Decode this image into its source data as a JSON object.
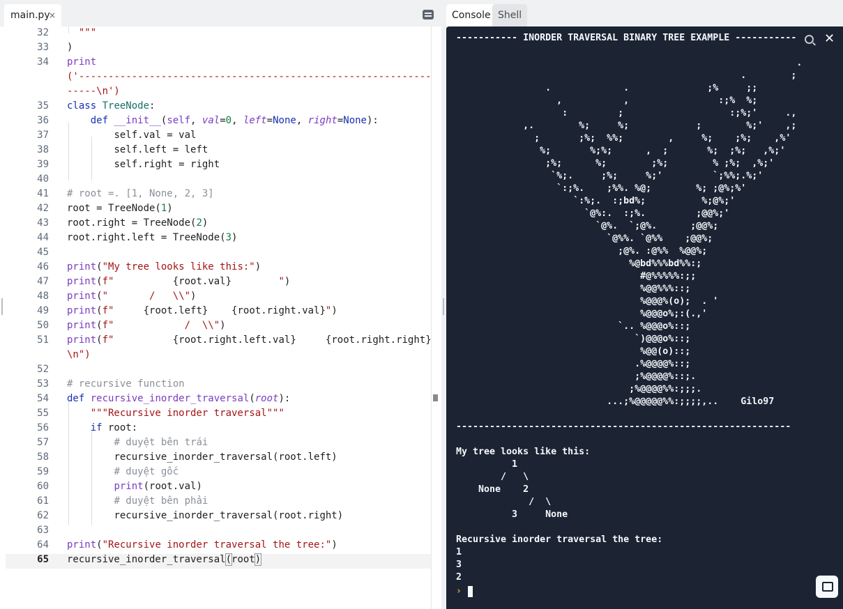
{
  "editor": {
    "file_tab": "main.py",
    "close_glyph": "×",
    "line_numbers": [
      "32",
      "33",
      "34",
      "35",
      "36",
      "37",
      "38",
      "39",
      "40",
      "41",
      "42",
      "43",
      "44",
      "45",
      "46",
      "47",
      "48",
      "49",
      "50",
      "51",
      "52",
      "53",
      "54",
      "55",
      "56",
      "57",
      "58",
      "59",
      "60",
      "61",
      "62",
      "63",
      "64",
      "65"
    ],
    "lines": {
      "l32": "  \"\"\"",
      "l33": ")",
      "l34a": "print",
      "l34b": "('--------------------------------------------------------------",
      "l34c": "-----\\n')",
      "l35_kw": "class",
      "l35_name": "TreeNode",
      "l36_def": "def",
      "l36_name": "__init__",
      "l36_self": "self",
      "l36_val": "val",
      "l36_zero": "0",
      "l36_left": "left",
      "l36_none1": "None",
      "l36_right": "right",
      "l36_none2": "None",
      "l37": "self.val = val",
      "l38": "self.left = left",
      "l39": "self.right = right",
      "l41": "# root =. [1, None, 2, 3]",
      "l42_a": "root = TreeNode(",
      "l42_n": "1",
      "l43_a": "root.right = TreeNode(",
      "l43_n": "2",
      "l44_a": "root.right.left = TreeNode(",
      "l44_n": "3",
      "l46_s": "\"My tree looks like this:\"",
      "l47_s1": "f\"          ",
      "l47_e": "{root.val}",
      "l47_s2": "        \"",
      "l48_s": "\"       /   \\\\\"",
      "l49_s1": "f\"     ",
      "l49_e1": "{root.left}",
      "l49_s2": "    ",
      "l49_e2": "{root.right.val}",
      "l49_s3": "\"",
      "l50_s": "f\"            /  \\\\\"",
      "l51_s1": "f\"          ",
      "l51_e1": "{root.right.left.val}",
      "l51_s2": "     ",
      "l51_e2": "{root.right.right}",
      "l51_cont": "\\n\")",
      "l53": "# recursive function",
      "l54_def": "def",
      "l54_name": "recursive_inorder_traversal",
      "l54_param": "root",
      "l55": "\"\"\"Recursive inorder traversal\"\"\"",
      "l56_kw": "if",
      "l56_rest": " root:",
      "l57": "# duyệt bên trái",
      "l58": "recursive_inorder_traversal(root.left)",
      "l59": "# duyệt gốc",
      "l60_fn": "print",
      "l60_rest": "(root.val)",
      "l61": "# duyệt bên phải",
      "l62": "recursive_inorder_traversal(root.right)",
      "l64_s": "\"Recursive inorder traversal the tree:\"",
      "l65_a": "recursive_inorder_traversal",
      "l65_b": "root",
      "print_kw": "print"
    }
  },
  "console": {
    "tabs": {
      "console": "Console",
      "shell": "Shell"
    },
    "output": "----------- INORDER TRAVERSAL BINARY TREE EXAMPLE -----------\n\n                                                             .\n                                                   .        ;\n                .             .              ;%     ;;\n                  ,           ,                :;%  %;\n                   :         ;                   :;%;'     .,\n            ,.        %;     %;            ;        %;'    ,;\n              ;       ;%;  %%;        ,     %;    ;%;    ,%'\n               %;       %;%;      ,  ;       %;  ;%;   ,%;'\n                ;%;      %;        ;%;        % ;%;  ,%;'\n                 `%;.     ;%;     %;'         `;%%;.%;'\n                  `:;%.    ;%%. %@;        %; ;@%;%'\n                     `:%;.  :;bd%;          %;@%;'\n                       `@%:.  :;%.         ;@@%;'\n                         `@%.  `;@%.      ;@@%;\n                           `@%%. `@%%    ;@@%;\n                             ;@%. :@%%  %@@%;\n                               %@bd%%%bd%%:;\n                                 #@%%%%%:;;\n                                 %@@%%%::;\n                                 %@@@%(o);  . '\n                                 %@@@o%;:(.,'\n                             `.. %@@@o%::;\n                                `)@@@o%::;\n                                 %@@(o)::;\n                                .%@@@@%::;\n                                ;%@@@@%::;.\n                               ;%@@@@%%:;;;.\n                           ...;%@@@@@%%:;;;;,..    Gilo97\n\n------------------------------------------------------------\n\nMy tree looks like this:\n          1\n        /   \\\n    None    2\n             /  \\\n          3     None\n\nRecursive inorder traversal the tree:\n1\n3\n2",
    "prompt": "›"
  },
  "icons": {
    "search": "search-icon",
    "clear": "clear-icon",
    "layout": "layout-icon",
    "chat": "chat-icon"
  },
  "colors": {
    "console_bg": "#1c2333",
    "prompt": "#e6b422",
    "keyword": "#1530b2",
    "string": "#a31515",
    "function": "#7a3cc4",
    "class": "#157066",
    "comment": "#8a8f98"
  }
}
